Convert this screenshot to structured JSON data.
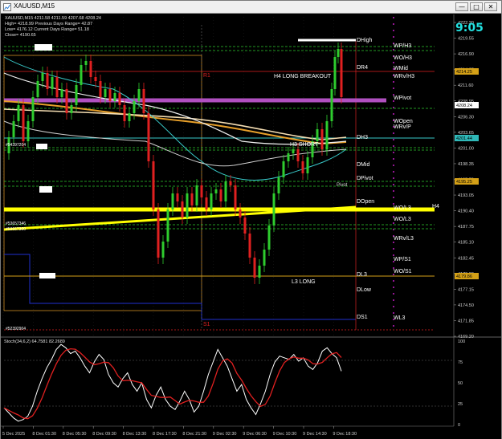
{
  "window": {
    "title": "XAUUSD,M15",
    "controls": {
      "minimize": "—",
      "maximize": "□",
      "close": "✕"
    }
  },
  "info": {
    "ohlc": "XAUUSD,M15  4211.58 4211.59 4207.68 4208.24",
    "line1": "High= 4218.99     Previous Days Range= 42.87",
    "line2": "Low= 4176.12    Current Days Range= 51.18",
    "line3": "Close= 4190.65"
  },
  "clock": "9:05",
  "stochastic": {
    "label": "Stoch(34,6,2) 64.7581 82.2689",
    "ticks": [
      "100",
      "75",
      "50",
      "25",
      "0"
    ]
  },
  "price_axis": {
    "ticks": [
      "4222.20",
      "4219.55",
      "4216.90",
      "4214.25",
      "4211.60",
      "4208.95",
      "4206.30",
      "4203.65",
      "4201.00",
      "4198.35",
      "4195.70",
      "4193.05",
      "4190.40",
      "4187.75",
      "4185.10",
      "4182.45",
      "4179.80",
      "4177.15",
      "4174.50",
      "4171.85",
      "4169.20"
    ],
    "markers": [
      {
        "text": "4214.25",
        "color": "#d4a017"
      },
      {
        "text": "4208.24",
        "color": "#ffffff"
      },
      {
        "text": "4201.44",
        "color": "#2fb8b8"
      },
      {
        "text": "4195.25",
        "color": "#d4a017"
      },
      {
        "text": "4179.86",
        "color": "#d4a017"
      }
    ]
  },
  "time_axis": [
    "5 Dec 2025",
    "8 Dec 01:30",
    "8 Dec 05:30",
    "8 Dec 09:30",
    "8 Dec 13:30",
    "8 Dec 17:30",
    "8 Dec 21:30",
    "9 Dec 02:30",
    "9 Dec 06:30",
    "9 Dec 10:30",
    "9 Dec 14:30",
    "9 Dec 18:30"
  ],
  "labels": {
    "dhigh": "DHigh",
    "dr4": "DR4",
    "dh3": "DH3",
    "dmid": "DMid",
    "dpivot": "DPivot",
    "dopen": "DOpen",
    "dl3": "DL3",
    "dlow": "DLow",
    "ds1": "DS1",
    "wph3": "WP/H3",
    "woh3": "WO/H3",
    "wmid": "WMid",
    "wrvh3": "WRv/H3",
    "wpivot": "WPivot",
    "wopen": "WOpen",
    "wrvp": "WRv/P",
    "wol3": "WO/L3",
    "wrvl3": "WRv/L3",
    "wps1": "WP/S1",
    "wos1": "WO/S1",
    "wl3": "WL3",
    "wol3b": "WO/L3",
    "h4": "H4",
    "r1": "R1",
    "s1": "S1",
    "pivot": "Pivot",
    "h4_long": "H4 LONG BREAKOUT",
    "h3_short": "H3 SHORT",
    "l3_long": "L3 LONG"
  },
  "tags": [
    "#54397204",
    "#53657346",
    "#53667300",
    "#52392904"
  ],
  "colors": {
    "background": "#000000",
    "grid": "#202020",
    "up": "#2ecc2e",
    "down": "#e02020",
    "magenta": "#d020d0",
    "yellow": "#ffff00",
    "orange": "#e8a02a",
    "cyan": "#38c8c8",
    "white": "#ffffff",
    "wheat": "#f5deb3",
    "blue": "#2030d0",
    "purple": "#9a50c8"
  }
}
